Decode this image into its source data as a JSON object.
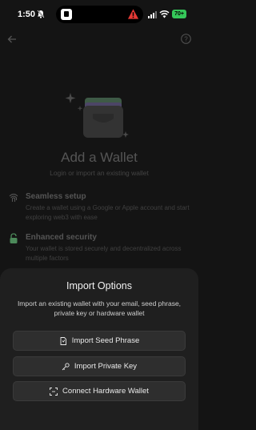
{
  "status_bar": {
    "time": "1:50",
    "battery": "70+"
  },
  "page": {
    "title": "Add a Wallet",
    "subtitle": "Login or import an existing wallet",
    "features": [
      {
        "title": "Seamless setup",
        "desc": "Create a wallet using a Google or Apple account and start exploring web3 with ease",
        "icon": "fingerprint-icon"
      },
      {
        "title": "Enhanced security",
        "desc": "Your wallet is stored securely and decentralized across multiple factors",
        "icon": "lock-icon"
      }
    ]
  },
  "sheet": {
    "title": "Import Options",
    "desc": "Import an existing wallet with your email, seed phrase, private key or hardware wallet",
    "buttons": [
      {
        "label": "Import Seed Phrase",
        "icon": "document-icon"
      },
      {
        "label": "Import Private Key",
        "icon": "key-icon"
      },
      {
        "label": "Connect Hardware Wallet",
        "icon": "scan-icon"
      }
    ]
  },
  "colors": {
    "background": "#141414",
    "sheet": "#1f1f1f",
    "button": "#2e2e2e",
    "warning": "#e53935",
    "battery": "#35c759"
  }
}
